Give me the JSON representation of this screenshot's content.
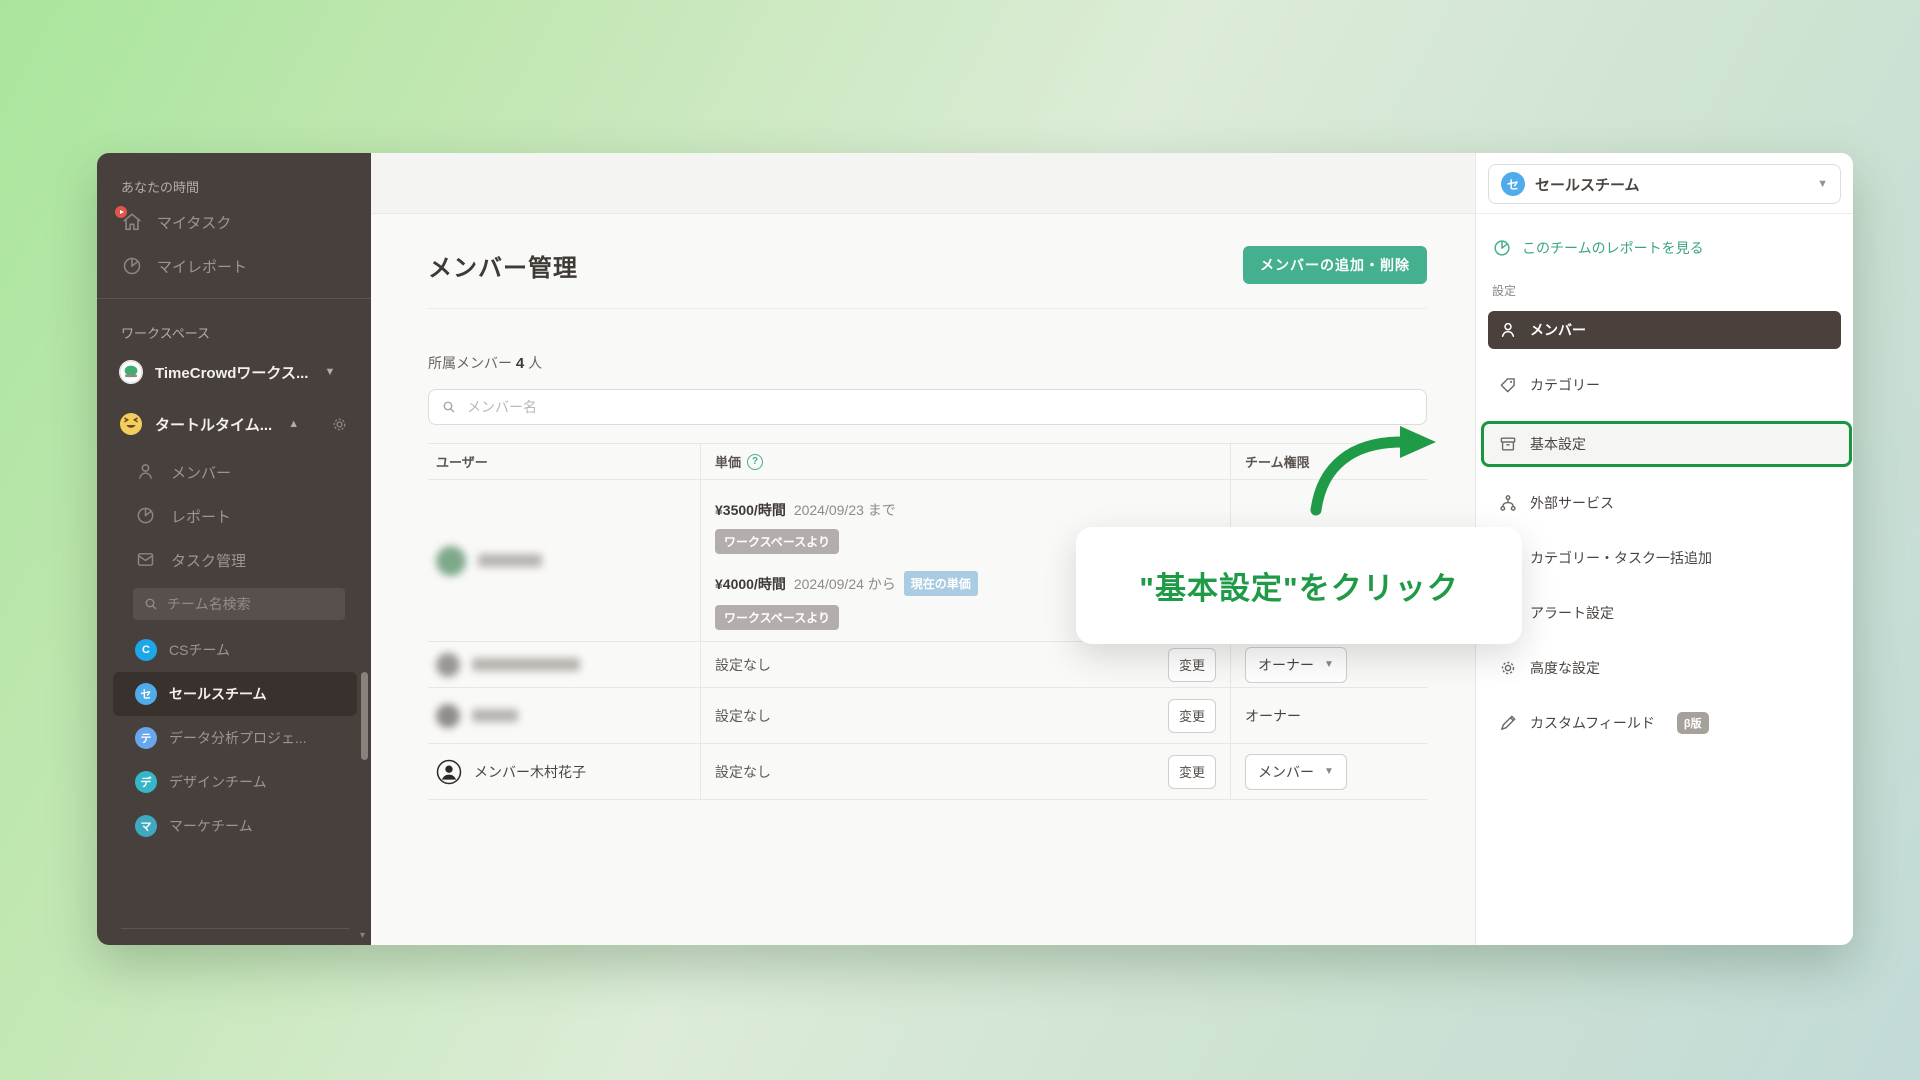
{
  "sidebar": {
    "section_your_time": "あなたの時間",
    "my_task": "マイタスク",
    "my_report": "マイレポート",
    "section_workspace": "ワークスペース",
    "workspace_1": "TimeCrowdワークス...",
    "workspace_2": "タートルタイム...",
    "menu_members": "メンバー",
    "menu_report": "レポート",
    "menu_task_admin": "タスク管理",
    "search_placeholder": "チーム名検索",
    "teams": [
      {
        "initial": "C",
        "label": "CSチーム",
        "color": "#1ba7e8"
      },
      {
        "initial": "セ",
        "label": "セールスチーム",
        "color": "#4fabea",
        "active": true
      },
      {
        "initial": "テ",
        "label": "データ分析プロジェ...",
        "color": "#6aa6ec"
      },
      {
        "initial": "デ",
        "label": "デザインチーム",
        "color": "#35b6c9"
      },
      {
        "initial": "マ",
        "label": "マーケチーム",
        "color": "#3fa9c0"
      }
    ]
  },
  "main": {
    "title": "メンバー管理",
    "add_remove_button": "メンバーの追加・削除",
    "member_count_prefix": "所属メンバー",
    "member_count": "4",
    "member_count_suffix": "人",
    "search_placeholder": "メンバー名",
    "table": {
      "col_user": "ユーザー",
      "col_rate": "単価",
      "col_role": "チーム権限",
      "row1": {
        "rate1_amount": "¥3500/時間",
        "rate1_period": "2024/09/23 まで",
        "rate1_source": "ワークスペースより",
        "rate2_amount": "¥4000/時間",
        "rate2_period": "2024/09/24 から",
        "rate2_badge": "現在の単価",
        "rate2_source": "ワークスペースより"
      },
      "row2": {
        "rate": "設定なし",
        "change": "変更",
        "role": "オーナー"
      },
      "row3": {
        "rate": "設定なし",
        "change": "変更",
        "role": "オーナー"
      },
      "row4": {
        "name": "メンバー木村花子",
        "rate": "設定なし",
        "change": "変更",
        "role": "メンバー"
      }
    }
  },
  "right_panel": {
    "team_selector": "セールスチーム",
    "team_selector_initial": "セ",
    "report_link": "このチームのレポートを見る",
    "settings_label": "設定",
    "menu_members": "メンバー",
    "menu_categories": "カテゴリー",
    "menu_basic_settings": "基本設定",
    "menu_external_services": "外部サービス",
    "menu_bulk_add": "カテゴリー・タスク一括追加",
    "menu_alert_settings": "アラート設定",
    "menu_advanced_settings": "高度な設定",
    "menu_custom_fields": "カスタムフィールド",
    "beta_badge": "β版"
  },
  "tooltip": {
    "text": "\"基本設定\"をクリック"
  },
  "colors": {
    "accent_teal": "#45b08f",
    "tutorial_green": "#1f9a47",
    "sidebar_bg": "#48403d",
    "current_rate_badge_bg": "#a9cce3",
    "source_badge_bg": "#b3aeab"
  }
}
